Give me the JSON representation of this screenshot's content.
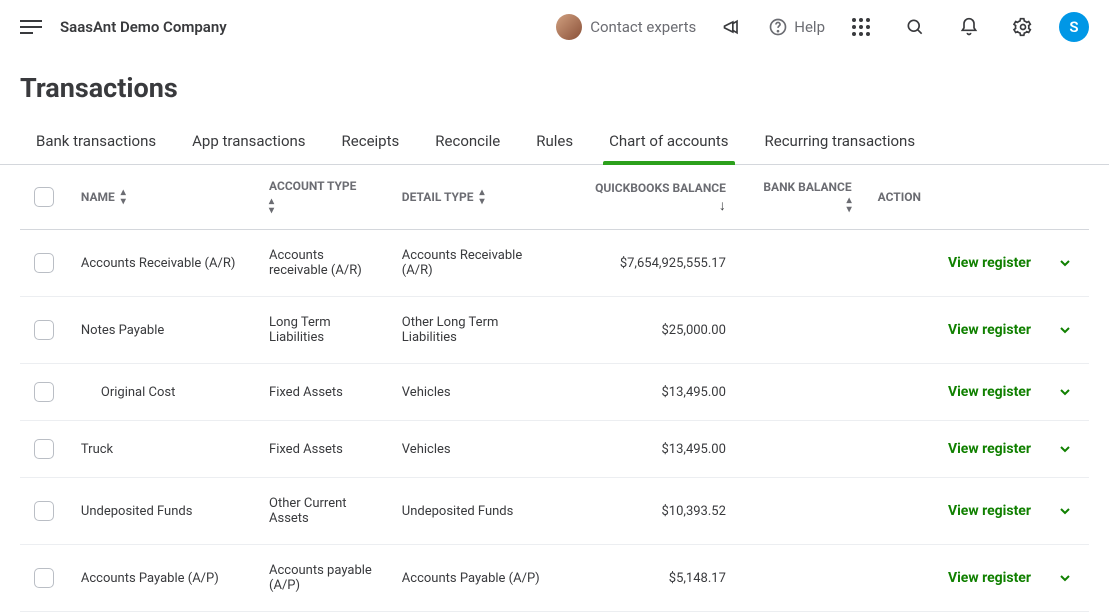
{
  "header": {
    "company_name": "SaasAnt Demo Company",
    "contact_label": "Contact experts",
    "help_label": "Help",
    "profile_initial": "S"
  },
  "page": {
    "title": "Transactions"
  },
  "tabs": [
    {
      "label": "Bank transactions",
      "active": false
    },
    {
      "label": "App transactions",
      "active": false
    },
    {
      "label": "Receipts",
      "active": false
    },
    {
      "label": "Reconcile",
      "active": false
    },
    {
      "label": "Rules",
      "active": false
    },
    {
      "label": "Chart of accounts",
      "active": true
    },
    {
      "label": "Recurring transactions",
      "active": false
    }
  ],
  "columns": {
    "name": "NAME",
    "account_type": "ACCOUNT TYPE",
    "detail_type": "DETAIL TYPE",
    "qb_balance": "QUICKBOOKS BALANCE",
    "bank_balance": "BANK BALANCE",
    "action": "ACTION"
  },
  "action_label": "View register",
  "rows": [
    {
      "name": "Accounts Receivable (A/R)",
      "account_type": "Accounts receivable (A/R)",
      "detail_type": "Accounts Receivable (A/R)",
      "qb_balance": "$7,654,925,555.17",
      "bank_balance": "",
      "indent": false
    },
    {
      "name": "Notes Payable",
      "account_type": "Long Term Liabilities",
      "detail_type": "Other Long Term Liabilities",
      "qb_balance": "$25,000.00",
      "bank_balance": "",
      "indent": false
    },
    {
      "name": "Original Cost",
      "account_type": "Fixed Assets",
      "detail_type": "Vehicles",
      "qb_balance": "$13,495.00",
      "bank_balance": "",
      "indent": true
    },
    {
      "name": "Truck",
      "account_type": "Fixed Assets",
      "detail_type": "Vehicles",
      "qb_balance": "$13,495.00",
      "bank_balance": "",
      "indent": false
    },
    {
      "name": "Undeposited Funds",
      "account_type": "Other Current Assets",
      "detail_type": "Undeposited Funds",
      "qb_balance": "$10,393.52",
      "bank_balance": "",
      "indent": false
    },
    {
      "name": "Accounts Payable (A/P)",
      "account_type": "Accounts payable (A/P)",
      "detail_type": "Accounts Payable (A/P)",
      "qb_balance": "$5,148.17",
      "bank_balance": "",
      "indent": false
    }
  ]
}
